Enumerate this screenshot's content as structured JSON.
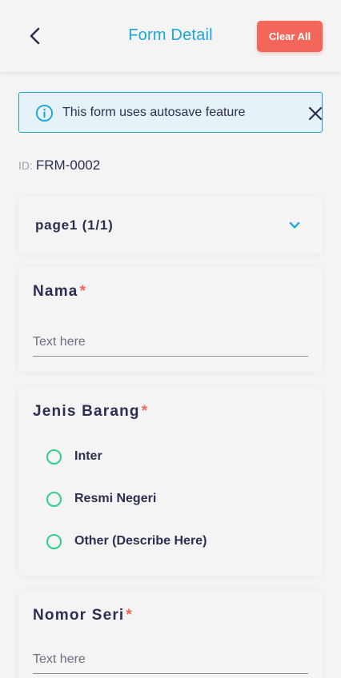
{
  "header": {
    "title": "Form Detail",
    "clear_label": "Clear All"
  },
  "alert": {
    "text": "This form uses autosave feature"
  },
  "form_id": {
    "label": "ID:",
    "value": "FRM-0002"
  },
  "page_selector": {
    "label": "page1 (1/1)"
  },
  "questions": [
    {
      "label": "Nama",
      "required_mark": "*",
      "placeholder": "Text here",
      "value": ""
    },
    {
      "label": "Jenis Barang",
      "required_mark": "*",
      "options": [
        "Inter",
        "Resmi Negeri",
        "Other (Describe Here)"
      ]
    },
    {
      "label": "Nomor Seri",
      "required_mark": "*",
      "placeholder": "Text here",
      "value": ""
    }
  ],
  "colors": {
    "accent": "#1aa6d8",
    "danger": "#f2675a",
    "radio": "#2fcf8a",
    "text": "#2b2f4f"
  }
}
